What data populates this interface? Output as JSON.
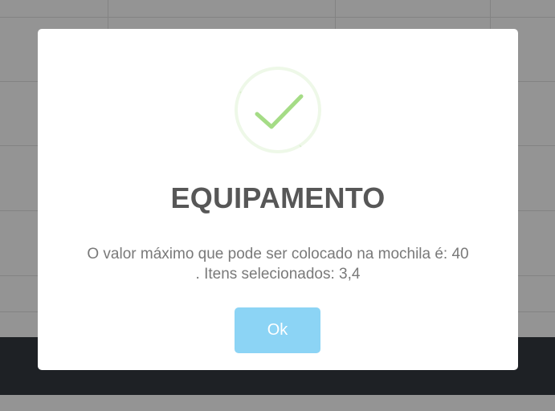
{
  "modal": {
    "title": "EQUIPAMENTO",
    "message_line1": "O valor máximo que pode ser colocado na mochila é: 40",
    "message_line2": ". Itens selecionados: 3,4",
    "ok_label": "Ok",
    "icon": "success-check-icon"
  },
  "colors": {
    "check": "#a5dc86",
    "check_ring": "#eef8e8",
    "button": "#8cd4f5",
    "title": "#575757",
    "text": "#797979",
    "footer": "#343a40"
  }
}
